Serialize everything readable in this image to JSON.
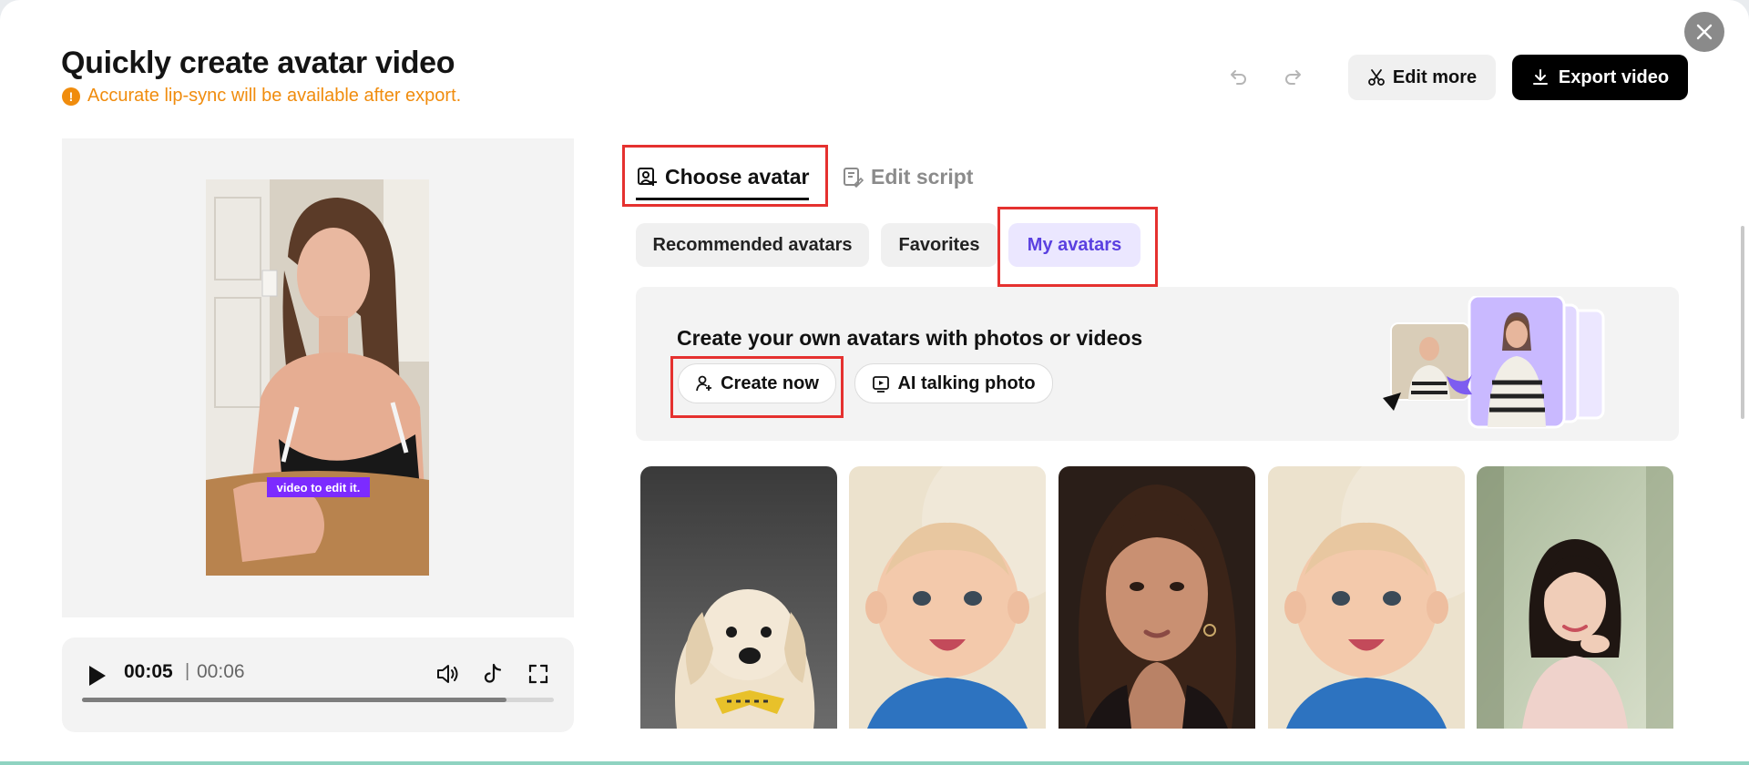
{
  "header": {
    "title": "Quickly create avatar video",
    "warning": "Accurate lip-sync will be available after export.",
    "warning_icon": "!",
    "edit_more_label": "Edit more",
    "export_label": "Export video"
  },
  "preview": {
    "caption_chip": "video to edit it."
  },
  "player": {
    "current_time": "00:05",
    "separator": "|",
    "total_time": "00:06",
    "progress": 0.9
  },
  "tabs": {
    "choose_avatar": "Choose avatar",
    "edit_script": "Edit script"
  },
  "filters": {
    "recommended": "Recommended avatars",
    "favorites": "Favorites",
    "my_avatars": "My avatars",
    "selected": "my_avatars"
  },
  "promo": {
    "title": "Create your own avatars with photos or videos",
    "create_now": "Create now",
    "ai_talking_photo": "AI talking photo"
  },
  "avatars": [
    {
      "subject": "dog with bow tie"
    },
    {
      "subject": "baby"
    },
    {
      "subject": "woman portrait"
    },
    {
      "subject": "baby"
    },
    {
      "subject": "woman in garden"
    }
  ],
  "colors": {
    "accent_purple": "#5a40e0",
    "warning_orange": "#f08c0d",
    "highlight_red": "#e5312f",
    "export_bg": "#000000"
  }
}
